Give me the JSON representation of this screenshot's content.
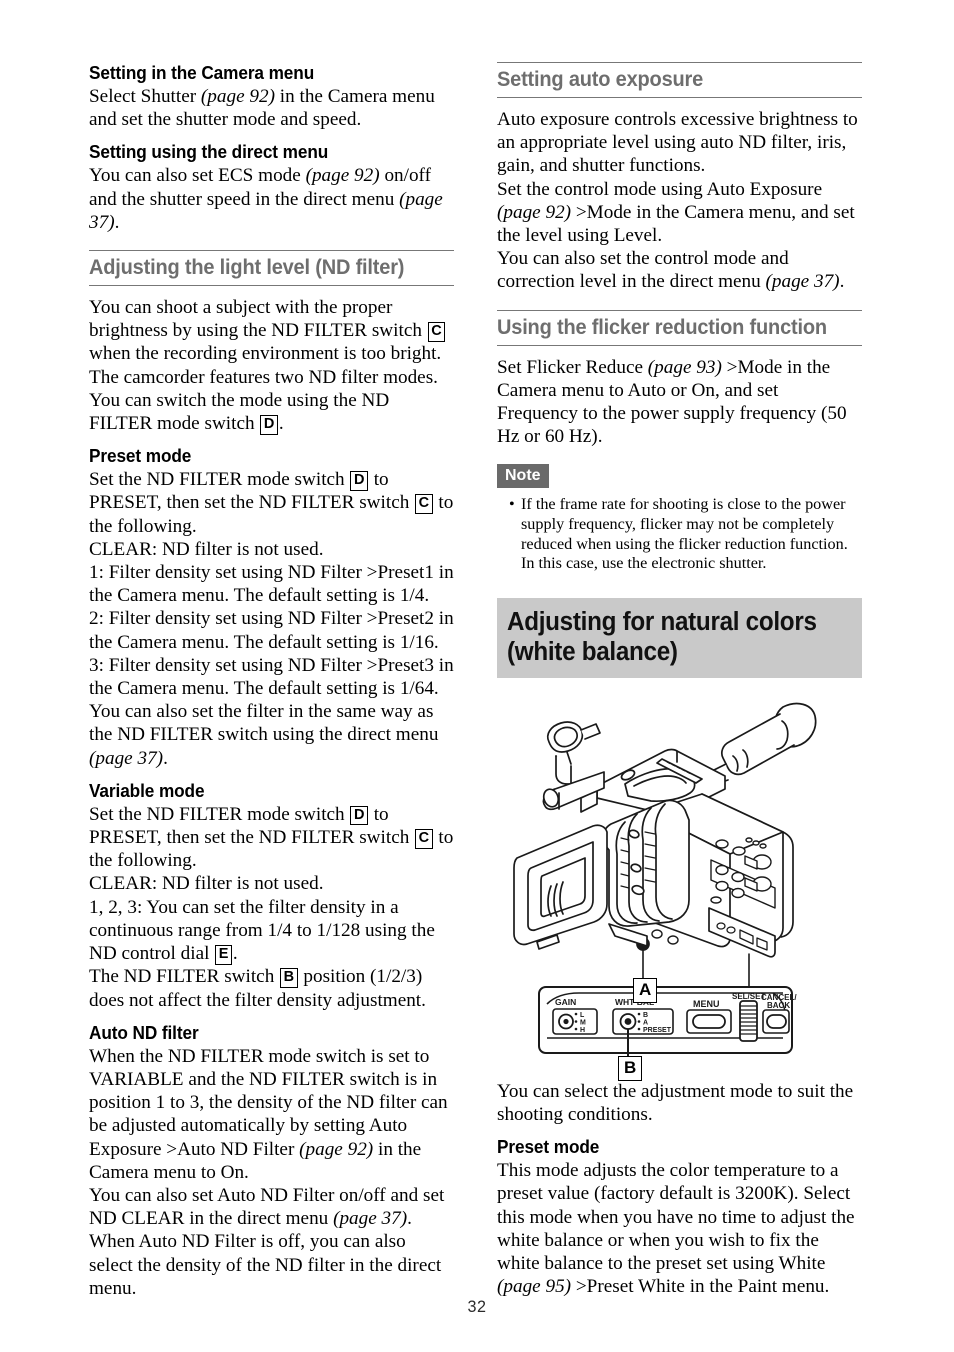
{
  "page_number": "32",
  "left_column": {
    "blocks": [
      {
        "kind": "subheading",
        "text": "Setting in the Camera menu"
      },
      {
        "kind": "para",
        "html": "Select Shutter <i>(page 92)</i> in the Camera menu and set the shutter mode and speed."
      },
      {
        "kind": "subheading",
        "text": "Setting using the direct menu"
      },
      {
        "kind": "para",
        "html": "You can also set ECS mode <i>(page 92)</i> on/off and the shutter speed in the direct menu <i>(page 37)</i>."
      },
      {
        "kind": "section",
        "text": "Adjusting the light level (ND filter)"
      },
      {
        "kind": "para",
        "html": "You can shoot a subject with the proper brightness by using the ND FILTER switch [C] when the recording environment is too bright. The camcorder features two ND filter modes. You can switch the mode using the ND FILTER mode switch [D]."
      },
      {
        "kind": "subheading",
        "text": "Preset mode"
      },
      {
        "kind": "para",
        "html": "Set the ND FILTER mode switch [D] to PRESET, then set the ND FILTER switch [C] to the following."
      },
      {
        "kind": "para",
        "html": "CLEAR: ND filter is not used."
      },
      {
        "kind": "para",
        "html": "1: Filter density set using ND Filter &gt;Preset1 in the Camera menu. The default setting is 1/4."
      },
      {
        "kind": "para",
        "html": "2: Filter density set using ND Filter &gt;Preset2 in the Camera menu. The default setting is 1/16."
      },
      {
        "kind": "para",
        "html": "3: Filter density set using ND Filter &gt;Preset3 in the Camera menu. The default setting is 1/64."
      },
      {
        "kind": "para",
        "html": "You can also set the filter in the same way as the ND FILTER switch using the direct menu <i>(page 37)</i>."
      },
      {
        "kind": "subheading",
        "text": "Variable mode"
      },
      {
        "kind": "para",
        "html": "Set the ND FILTER mode switch [D] to PRESET, then set the ND FILTER switch [C] to the following."
      },
      {
        "kind": "para",
        "html": "CLEAR: ND filter is not used."
      },
      {
        "kind": "para",
        "html": "1, 2, 3: You can set the filter density in a continuous range from 1/4 to 1/128 using the ND control dial [E]."
      },
      {
        "kind": "para",
        "html": "The ND FILTER switch [B] position (1/2/3) does not affect the filter density adjustment."
      },
      {
        "kind": "subheading",
        "text": "Auto ND filter"
      },
      {
        "kind": "para",
        "html": "When the ND FILTER mode switch is set to VARIABLE and the ND FILTER switch is in position 1 to 3, the density of the ND filter can be adjusted automatically by setting Auto Exposure &gt;Auto ND Filter <i>(page 92)</i> in the Camera menu to On."
      },
      {
        "kind": "para",
        "html": "You can also set Auto ND Filter on/off and set ND CLEAR in the direct menu <i>(page 37)</i>."
      },
      {
        "kind": "para",
        "html": "When Auto ND Filter is off, you can also select the density of the ND filter in the direct menu."
      }
    ]
  },
  "right_column": {
    "section_auto_exposure": "Setting auto exposure",
    "auto_exposure_paras": [
      "Auto exposure controls excessive brightness to an appropriate level using auto ND filter, iris, gain, and shutter functions.",
      "Set the control mode using Auto Exposure <i>(page 92)</i> &gt;Mode in the Camera menu, and set the level using Level.",
      "You can also set the control mode and correction level in the direct menu <i>(page 37)</i>."
    ],
    "section_flicker": "Using the flicker reduction function",
    "flicker_para": "Set Flicker Reduce <i>(page 93)</i> &gt;Mode in the Camera menu to Auto or On, and set Frequency to the power supply frequency (50 Hz or 60 Hz).",
    "note_badge": "Note",
    "notes": [
      "If the frame rate for shooting is close to the power supply frequency, flicker may not be completely reduced when using the flicker reduction function. In this case, use the electronic shutter."
    ],
    "chapter_title": "Adjusting for natural colors (white balance)",
    "figure": {
      "callout_a": "A",
      "callout_b": "B",
      "panel_labels": {
        "gain": "GAIN",
        "gain_positions": [
          "L",
          "M",
          "H"
        ],
        "wht_bal": "WHT BAL",
        "wht_bal_positions": [
          "B",
          "A",
          "PRESET"
        ],
        "menu": "MENU",
        "sel_set": "SEL/SET",
        "cancel_back_line1": "CANCEL/",
        "cancel_back_line2": "BACK"
      }
    },
    "after_figure_para": "You can select the adjustment mode to suit the shooting conditions.",
    "preset_mode_heading": "Preset mode",
    "preset_mode_para": "This mode adjusts the color temperature to a preset value (factory default is 3200K). Select this mode when you have no time to adjust the white balance or when you wish to fix the white balance to the preset set using White <i>(page 95)</i> &gt;Preset White in the Paint menu."
  }
}
